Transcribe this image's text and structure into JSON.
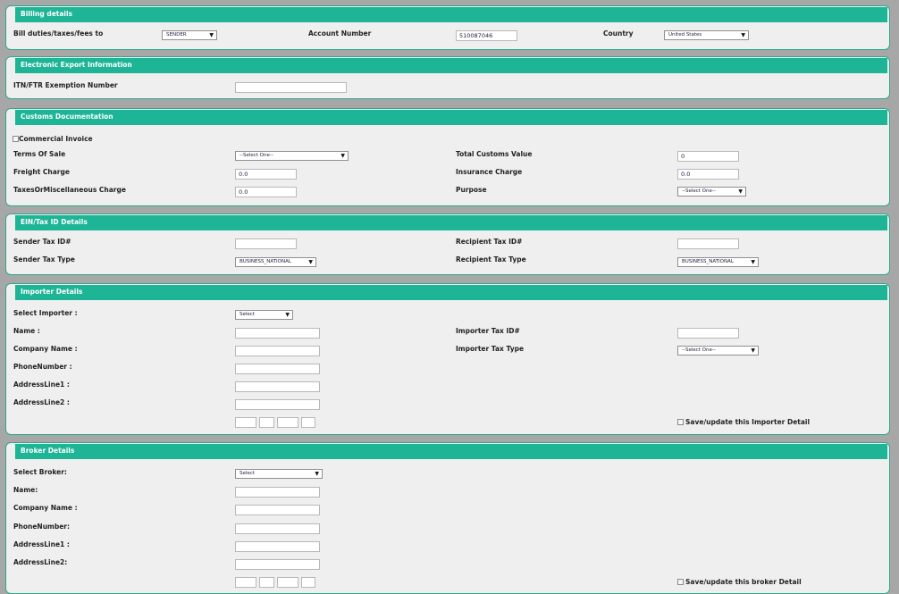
{
  "billing": {
    "title": "Billing details",
    "bill_label": "Bill duties/taxes/fees to",
    "bill_value": "SENDER",
    "account_label": "Account Number",
    "account_value": "510087046",
    "country_label": "Country",
    "country_value": "United States"
  },
  "export": {
    "title": "Electronic Export Information",
    "itn_label": "ITN/FTR Exemption Number",
    "itn_value": ""
  },
  "customs": {
    "title": "Customs Documentation",
    "commercial_invoice_label": "Commercial Invoice",
    "commercial_invoice_checked": false,
    "terms_label": "Terms Of Sale",
    "terms_value": "--Select One--",
    "total_value_label": "Total Customs Value",
    "total_value": "0",
    "freight_label": "Freight Charge",
    "freight_value": "0.0",
    "insurance_label": "Insurance Charge",
    "insurance_value": "0.0",
    "taxes_label": "TaxesOrMiscellaneous Charge",
    "taxes_value": "0.0",
    "purpose_label": "Purpose",
    "purpose_value": "--Select One--"
  },
  "ein": {
    "title": "EIN/Tax ID Details",
    "sender_id_label": "Sender Tax ID#",
    "sender_id_value": "",
    "recipient_id_label": "Recipient Tax ID#",
    "recipient_id_value": "",
    "sender_type_label": "Sender Tax Type",
    "sender_type_value": "BUSINESS_NATIONAL",
    "recipient_type_label": "Recipient Tax Type",
    "recipient_type_value": "BUSINESS_NATIONAL"
  },
  "importer": {
    "title": "Importer Details",
    "select_label": "Select Importer :",
    "select_value": "Select",
    "name_label": "Name :",
    "company_label": "Company Name :",
    "phone_label": "PhoneNumber :",
    "address1_label": "AddressLine1 :",
    "address2_label": "AddressLine2 :",
    "tax_id_label": "Importer Tax ID#",
    "tax_type_label": "Importer Tax Type",
    "tax_type_value": "--Select One--",
    "save_label": "Save/update this Importer Detail"
  },
  "broker": {
    "title": "Broker Details",
    "select_label": "Select Broker:",
    "select_value": "Select",
    "name_label": "Name:",
    "company_label": "Company Name :",
    "phone_label": "PhoneNumber:",
    "address1_label": "AddressLine1 :",
    "address2_label": "AddressLine2:",
    "save_label": "Save/update this broker Detail"
  },
  "icons": {
    "dropdown_arrow": "▼",
    "dropdown_icon_name": "chevron-down-icon"
  },
  "colors": {
    "header": "#1db596",
    "border": "#2aaa8a",
    "panel_bg": "#efefef",
    "page_bg": "#a7a7a7"
  }
}
